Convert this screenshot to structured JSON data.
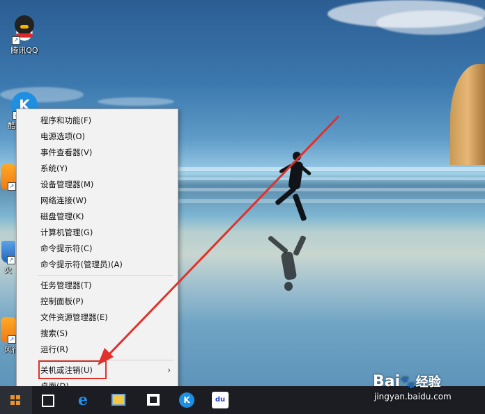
{
  "desktop": {
    "icons": [
      {
        "label": "腾讯QQ",
        "icon": "qq-penguin-icon"
      },
      {
        "label": "酷",
        "icon": "kugou-icon"
      },
      {
        "label": "",
        "icon": "orange-app-icon"
      },
      {
        "label": "火",
        "icon": "shield-app-icon"
      },
      {
        "label": "风行",
        "icon": "orange-app-icon"
      }
    ]
  },
  "menu": {
    "group1": [
      "程序和功能(F)",
      "电源选项(O)",
      "事件查看器(V)",
      "系统(Y)",
      "设备管理器(M)",
      "网络连接(W)",
      "磁盘管理(K)",
      "计算机管理(G)",
      "命令提示符(C)",
      "命令提示符(管理员)(A)"
    ],
    "group2": [
      "任务管理器(T)",
      "控制面板(P)",
      "文件资源管理器(E)",
      "搜索(S)",
      "运行(R)"
    ],
    "group3": [
      "关机或注销(U)",
      "桌面(D)"
    ],
    "submenu_arrow": "›"
  },
  "taskbar": {
    "items": [
      "windows-start-icon",
      "task-view-icon",
      "edge-icon",
      "store-icon",
      "windows-store-icon",
      "kugou-icon",
      "baidu-app-icon"
    ]
  },
  "watermark": {
    "brand": "Bai",
    "brand_suffix": "经验",
    "url": "jingyan.baidu.com"
  },
  "colors": {
    "highlight": "#e0312a",
    "taskbar": "#1b1d22",
    "menu_bg": "#f2f2f2"
  }
}
